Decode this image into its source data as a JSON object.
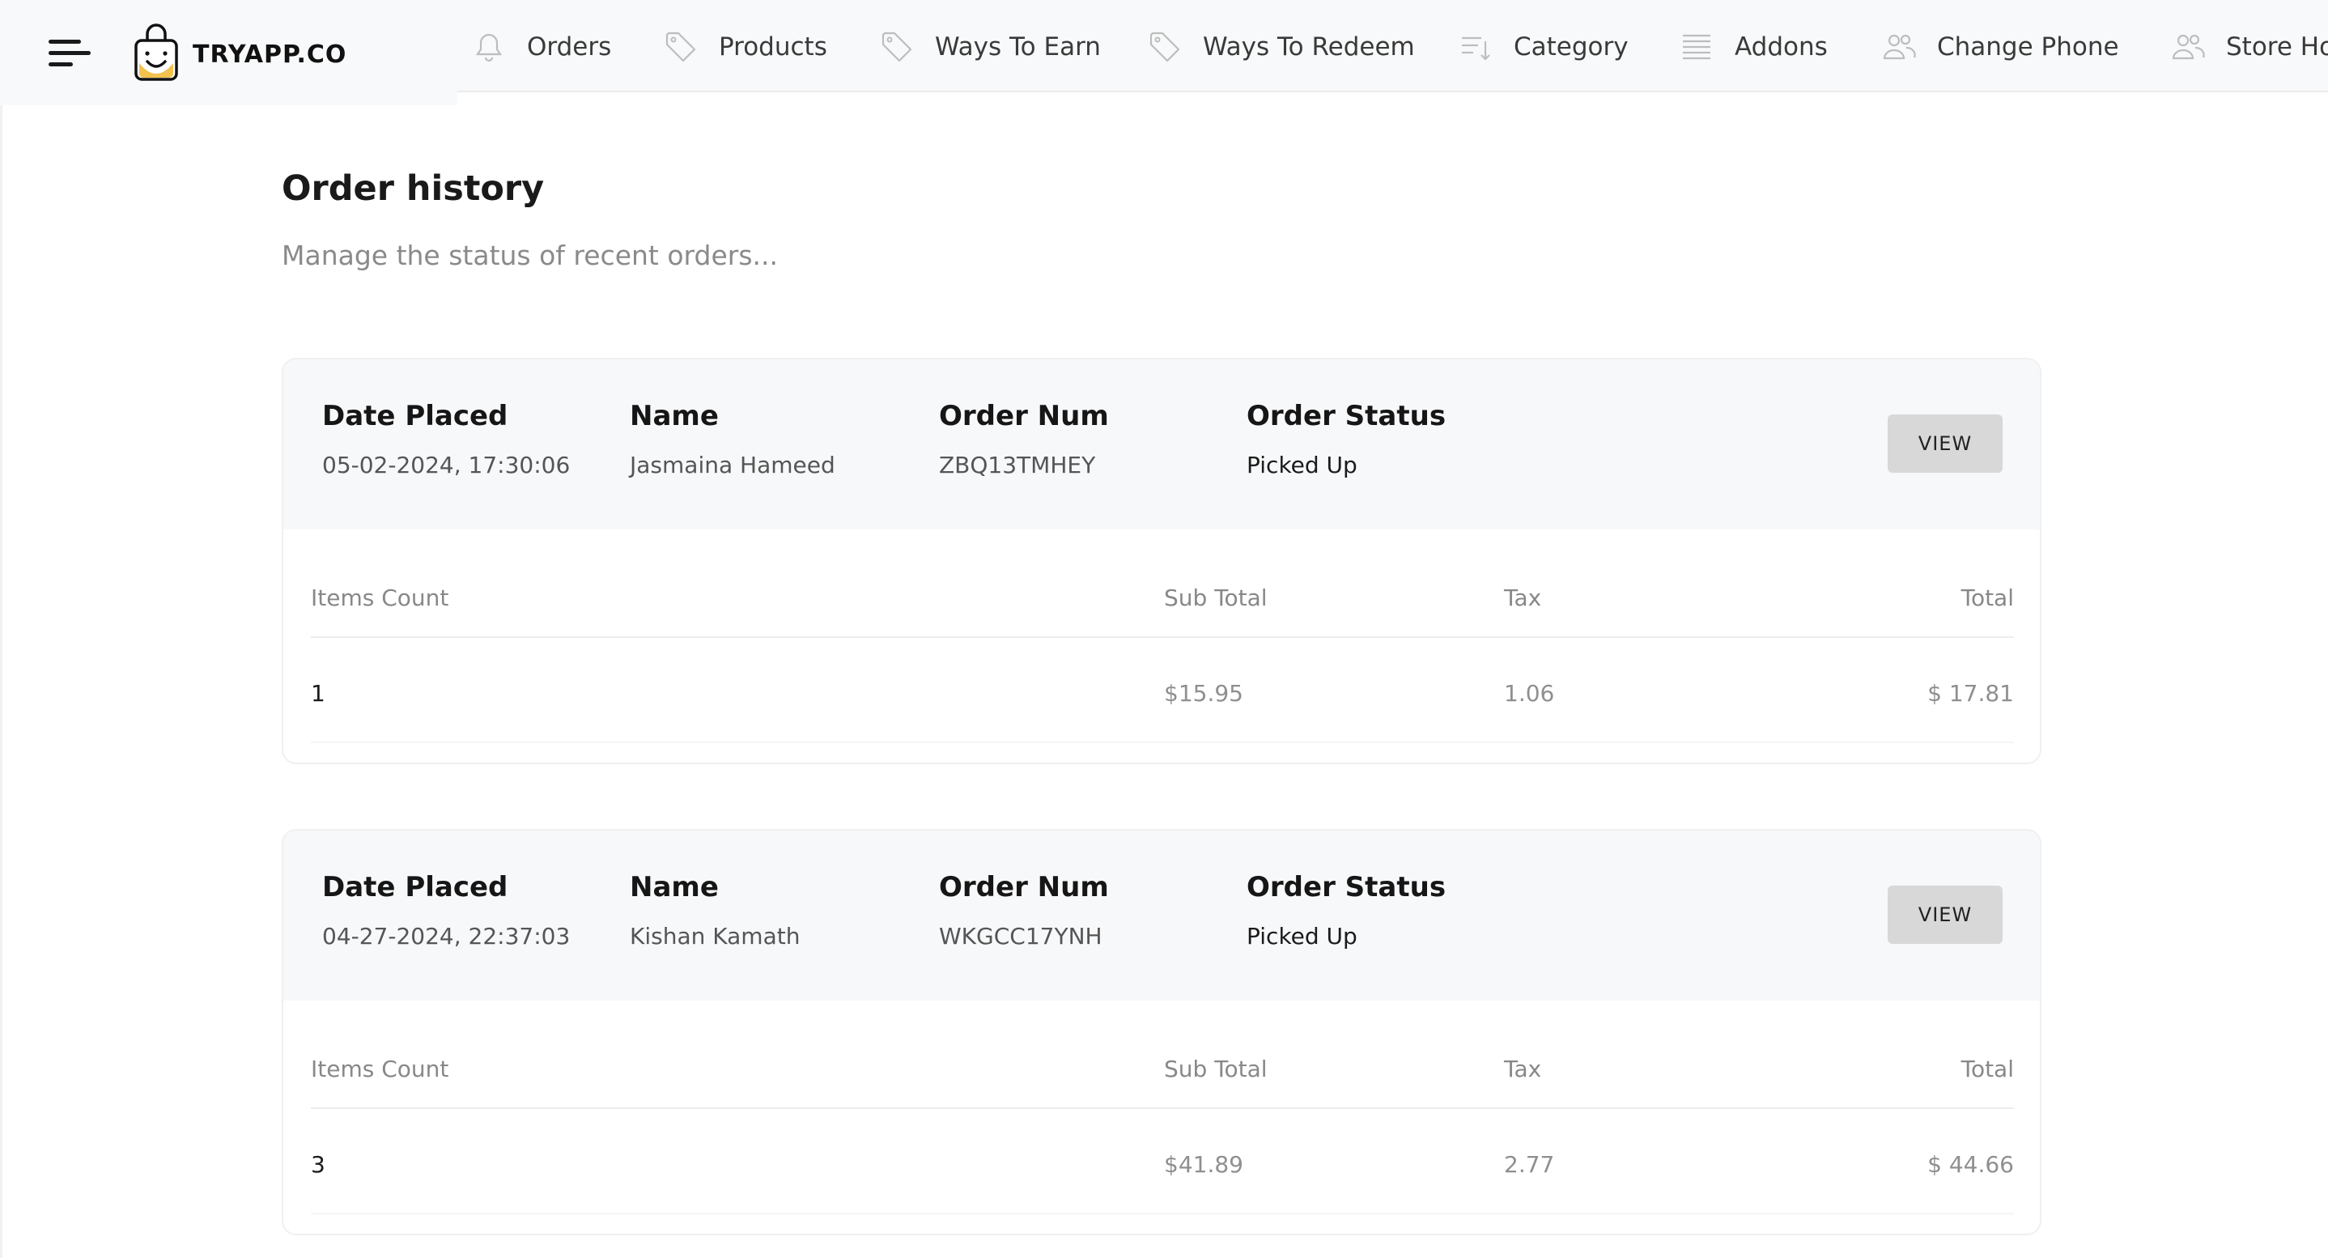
{
  "app": {
    "brand": "TRYAPP.CO"
  },
  "nav": {
    "items": [
      {
        "label": "Orders",
        "icon": "bell-icon"
      },
      {
        "label": "Products",
        "icon": "tag-icon"
      },
      {
        "label": "Ways To Earn",
        "icon": "tag-icon"
      },
      {
        "label": "Ways To Redeem",
        "icon": "tag-icon"
      },
      {
        "label": "Category",
        "icon": "sort-list-icon"
      },
      {
        "label": "Addons",
        "icon": "list-icon"
      },
      {
        "label": "Change Phone",
        "icon": "users-icon"
      },
      {
        "label": "Store Ho",
        "icon": "users-icon"
      }
    ]
  },
  "page": {
    "title": "Order history",
    "subtitle": "Manage the status of recent orders..."
  },
  "labels": {
    "date_placed": "Date Placed",
    "name": "Name",
    "order_num": "Order Num",
    "order_status": "Order Status",
    "view": "VIEW",
    "items_count": "Items Count",
    "sub_total": "Sub Total",
    "tax": "Tax",
    "total": "Total"
  },
  "orders": [
    {
      "date_placed": "05-02-2024, 17:30:06",
      "name": "Jasmaina Hameed",
      "order_num": "ZBQ13TMHEY",
      "status": "Picked Up",
      "items_count": "1",
      "sub_total": "$15.95",
      "tax": "1.06",
      "total": "$ 17.81"
    },
    {
      "date_placed": "04-27-2024, 22:37:03",
      "name": "Kishan Kamath",
      "order_num": "WKGCC17YNH",
      "status": "Picked Up",
      "items_count": "3",
      "sub_total": "$41.89",
      "tax": "2.77",
      "total": "$ 44.66"
    }
  ]
}
